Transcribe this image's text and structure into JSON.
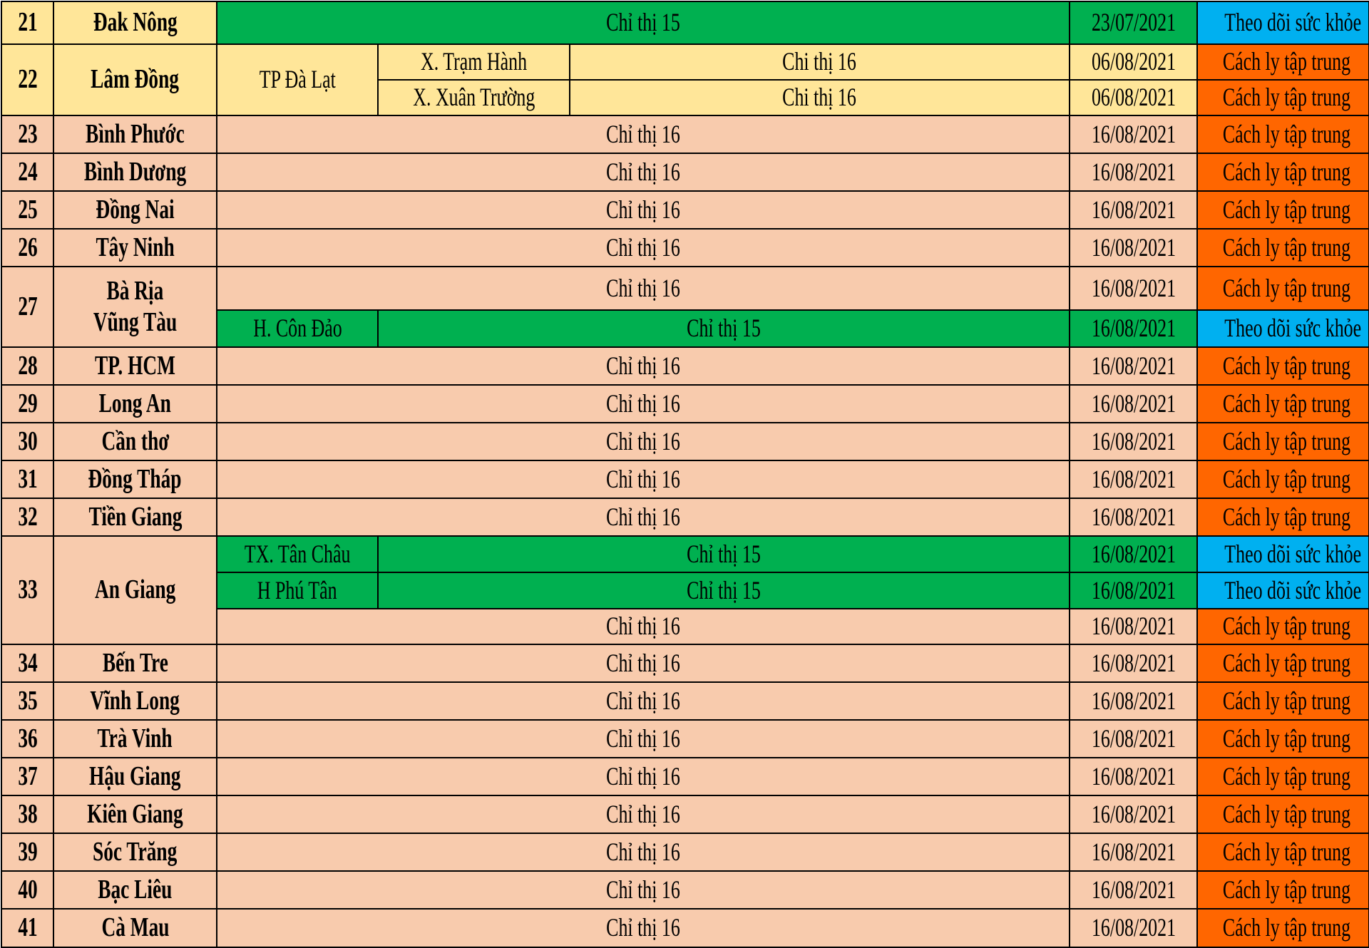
{
  "palette": {
    "yellow": "#ffe699",
    "peach": "#f8cbad",
    "green": "#00b050",
    "blue": "#00b0f0",
    "orange": "#ff6600"
  },
  "rows": [
    {
      "stt": "21",
      "province": "Đak Nông",
      "measure": "Chỉ thị 15",
      "date": "23/07/2021",
      "status": "Theo dõi sức khỏe"
    },
    {
      "stt": "22",
      "province": "Lâm Đồng",
      "district": "TP Đà Lạt",
      "sub": [
        {
          "commune": "X. Trạm Hành",
          "measure": "Chi thị 16",
          "date": "06/08/2021",
          "status": "Cách ly tập trung"
        },
        {
          "commune": "X. Xuân Trường",
          "measure": "Chi thị 16",
          "date": "06/08/2021",
          "status": "Cách ly tập trung"
        }
      ]
    },
    {
      "stt": "23",
      "province": "Bình Phước",
      "measure": "Chỉ thị 16",
      "date": "16/08/2021",
      "status": "Cách ly tập trung"
    },
    {
      "stt": "24",
      "province": "Bình Dương",
      "measure": "Chỉ thị 16",
      "date": "16/08/2021",
      "status": "Cách ly tập trung"
    },
    {
      "stt": "25",
      "province": "Đồng Nai",
      "measure": "Chỉ thị 16",
      "date": "16/08/2021",
      "status": "Cách ly tập trung"
    },
    {
      "stt": "26",
      "province": "Tây Ninh",
      "measure": "Chỉ thị 16",
      "date": "16/08/2021",
      "status": "Cách ly tập trung"
    },
    {
      "stt": "27",
      "province_line1": "Bà Rịa",
      "province_line2": "Vũng Tàu",
      "main": {
        "measure": "Chỉ thị 16",
        "date": "16/08/2021",
        "status": "Cách ly tập trung"
      },
      "sub": {
        "district": "H. Côn Đảo",
        "measure": "Chỉ thị 15",
        "date": "16/08/2021",
        "status": "Theo dõi sức khỏe"
      }
    },
    {
      "stt": "28",
      "province": "TP. HCM",
      "measure": "Chỉ thị 16",
      "date": "16/08/2021",
      "status": "Cách ly tập trung"
    },
    {
      "stt": "29",
      "province": "Long An",
      "measure": "Chỉ thị 16",
      "date": "16/08/2021",
      "status": "Cách ly tập trung"
    },
    {
      "stt": "30",
      "province": "Cần thơ",
      "measure": "Chỉ thị 16",
      "date": "16/08/2021",
      "status": "Cách ly tập trung"
    },
    {
      "stt": "31",
      "province": "Đồng Tháp",
      "measure": "Chỉ thị 16",
      "date": "16/08/2021",
      "status": "Cách ly tập trung"
    },
    {
      "stt": "32",
      "province": "Tiền Giang",
      "measure": "Chỉ thị 16",
      "date": "16/08/2021",
      "status": "Cách ly tập trung"
    },
    {
      "stt": "33",
      "province": "An Giang",
      "sub": [
        {
          "district": "TX. Tân Châu",
          "measure": "Chỉ thị 15",
          "date": "16/08/2021",
          "status": "Theo dõi sức khỏe"
        },
        {
          "district": "H Phú Tân",
          "measure": "Chỉ thị 15",
          "date": "16/08/2021",
          "status": "Theo dõi sức khỏe"
        }
      ],
      "main": {
        "measure": "Chỉ thị 16",
        "date": "16/08/2021",
        "status": "Cách ly tập trung"
      }
    },
    {
      "stt": "34",
      "province": "Bến Tre",
      "measure": "Chỉ thị 16",
      "date": "16/08/2021",
      "status": "Cách ly tập trung"
    },
    {
      "stt": "35",
      "province": "Vĩnh Long",
      "measure": "Chỉ thị 16",
      "date": "16/08/2021",
      "status": "Cách ly tập trung"
    },
    {
      "stt": "36",
      "province": "Trà Vinh",
      "measure": "Chỉ thị 16",
      "date": "16/08/2021",
      "status": "Cách ly tập trung"
    },
    {
      "stt": "37",
      "province": "Hậu Giang",
      "measure": "Chỉ thị 16",
      "date": "16/08/2021",
      "status": "Cách ly tập trung"
    },
    {
      "stt": "38",
      "province": "Kiên Giang",
      "measure": "Chỉ thị 16",
      "date": "16/08/2021",
      "status": "Cách ly tập trung"
    },
    {
      "stt": "39",
      "province": "Sóc Trăng",
      "measure": "Chỉ thị 16",
      "date": "16/08/2021",
      "status": "Cách ly tập trung"
    },
    {
      "stt": "40",
      "province": "Bạc Liêu",
      "measure": "Chỉ thị 16",
      "date": "16/08/2021",
      "status": "Cách ly tập trung"
    },
    {
      "stt": "41",
      "province": "Cà Mau",
      "measure": "Chỉ thị 16",
      "date": "16/08/2021",
      "status": "Cách ly tập trung"
    }
  ]
}
